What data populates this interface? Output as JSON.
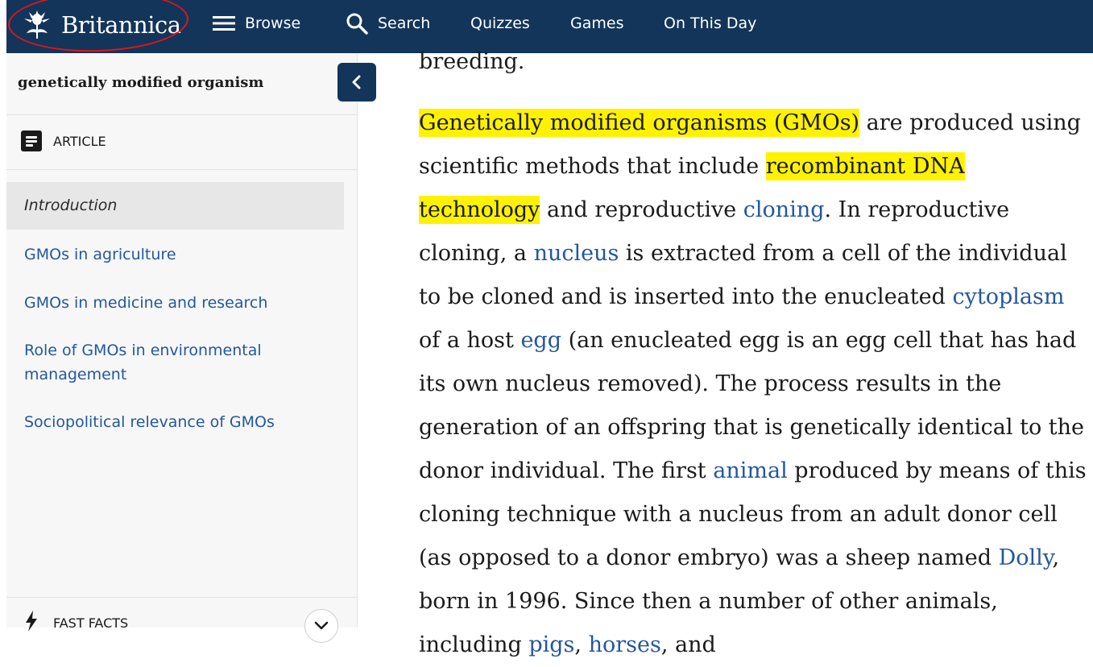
{
  "topbar": {
    "brand": "Britannica",
    "nav": {
      "browse": "Browse",
      "search": "Search",
      "quizzes": "Quizzes",
      "games": "Games",
      "on_this_day": "On This Day"
    },
    "annotation_color": "#e2141b",
    "background": "#13355a"
  },
  "sidebar": {
    "title": "genetically modified organism",
    "article_label": "ARTICLE",
    "toc": [
      "Introduction",
      "GMOs in agriculture",
      "GMOs in medicine and research",
      "Role of GMOs in environmental management",
      "Sociopolitical relevance of GMOs"
    ],
    "fast_facts": "FAST FACTS"
  },
  "article": {
    "lead_fragment": "breeding.",
    "hl1": "Genetically modified organisms (GMOs)",
    "t1": " are produced using scientific methods that include ",
    "hl2": "recombinant DNA technology",
    "t2": " and reproductive ",
    "link_cloning": "cloning",
    "t3": ". In reproductive cloning, a ",
    "link_nucleus": "nucleus",
    "t4": " is extracted from a cell of the individual to be cloned and is inserted into the enucleated ",
    "link_cytoplasm": "cytoplasm",
    "t5": " of a host ",
    "link_egg": "egg",
    "t6": " (an enucleated egg is an egg cell that has had its own nucleus removed). The process results in the generation of an offspring that is genetically identical to the donor individual. The first ",
    "link_animal": "animal",
    "t7": " produced by means of this cloning technique with a nucleus from an adult donor cell (as opposed to a donor embryo) was a sheep named ",
    "link_dolly": "Dolly",
    "t8": ", born in 1996. Since then a number of other animals, including ",
    "link_pigs": "pigs",
    "t9": ", ",
    "link_horses": "horses",
    "t10": ", and",
    "highlight_color": "#fff200",
    "link_color": "#23589e"
  }
}
